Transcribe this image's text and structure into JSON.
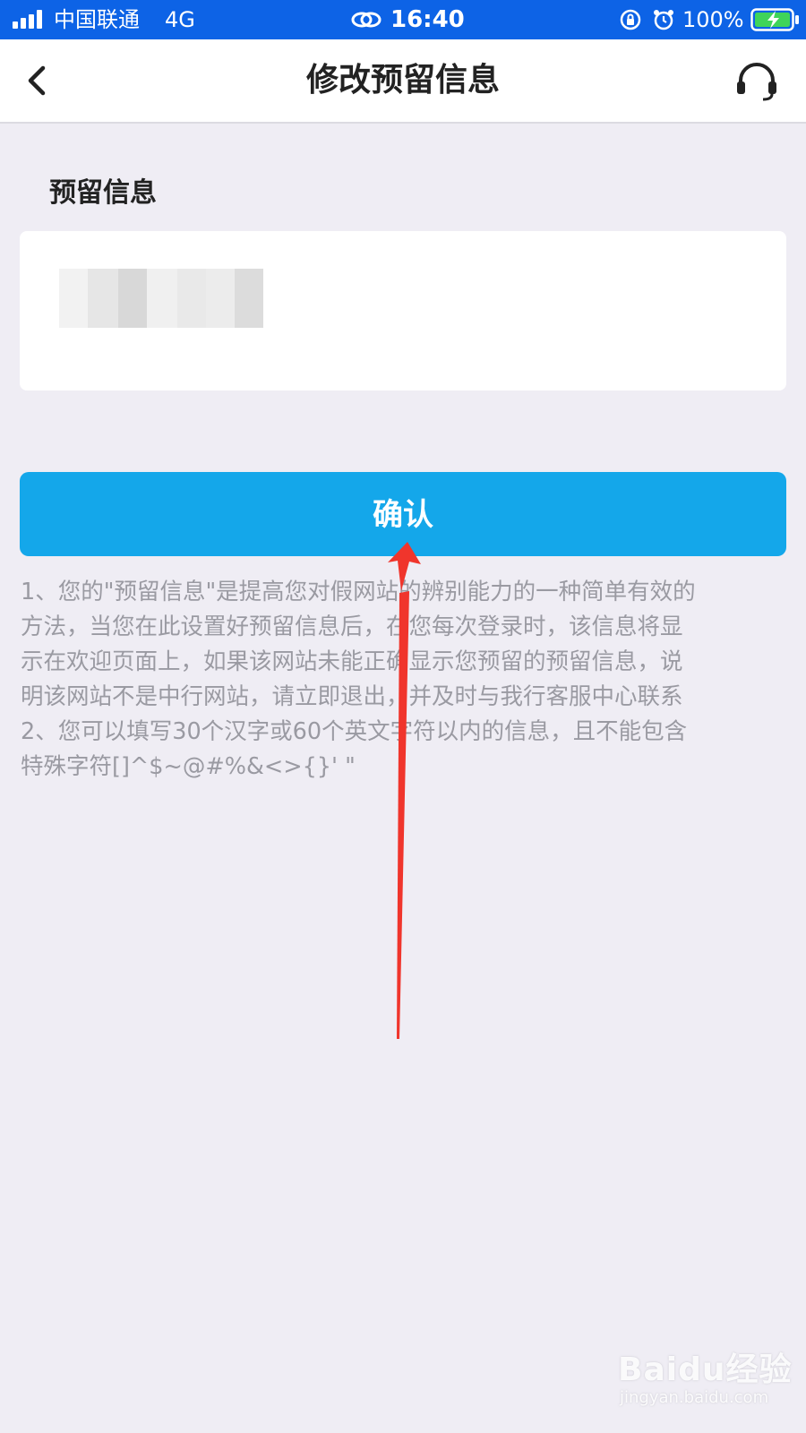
{
  "status_bar": {
    "carrier": "中国联通",
    "network": "4G",
    "time": "16:40",
    "battery": "100%",
    "icons": [
      "signal-icon",
      "link-icon",
      "orientation-lock-icon",
      "alarm-icon",
      "battery-charging-icon"
    ],
    "background": "#0d63e6"
  },
  "nav": {
    "title": "修改预留信息",
    "icons": [
      "back-icon",
      "customer-service-icon"
    ]
  },
  "form": {
    "label": "预留信息",
    "value_obscured": true
  },
  "confirm_label": "确认",
  "notes": [
    "1、您的\"预留信息\"是提高您对假网站的辨别能力的一种简单有效的",
    "方法，当您在此设置好预留信息后，在您每次登录时，该信息将显",
    "示在欢迎页面上，如果该网站未能正确显示您预留的预留信息，说",
    "明该网站不是中行网站，请立即退出，并及时与我行客服中心联系",
    "2、您可以填写30个汉字或60个英文字符以内的信息，且不能包含",
    "特殊字符[]^$~@#%&<>{}' \""
  ],
  "watermark": {
    "brand": "Baidu经验",
    "url": "jingyan.baidu.com"
  },
  "colors": {
    "accent": "#14a7ea",
    "background": "#efedf4",
    "annotation_arrow": "#f0352c"
  }
}
